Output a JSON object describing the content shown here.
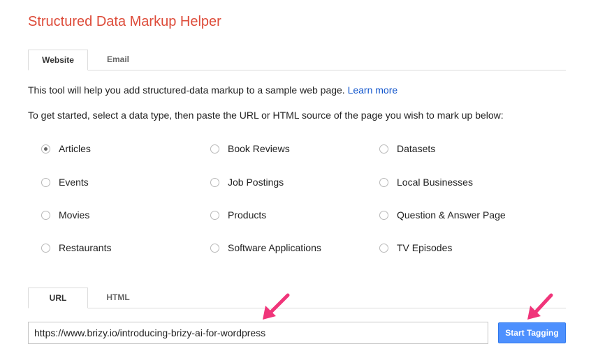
{
  "app": {
    "title": "Structured Data Markup Helper"
  },
  "source_tabs": [
    {
      "label": "Website",
      "active": true
    },
    {
      "label": "Email",
      "active": false
    }
  ],
  "intro": {
    "text": "This tool will help you add structured-data markup to a sample web page.",
    "link": "Learn more"
  },
  "instructions": "To get started, select a data type, then paste the URL or HTML source of the page you wish to mark up below:",
  "data_types": [
    {
      "label": "Articles",
      "checked": true
    },
    {
      "label": "Book Reviews",
      "checked": false
    },
    {
      "label": "Datasets",
      "checked": false
    },
    {
      "label": "Events",
      "checked": false
    },
    {
      "label": "Job Postings",
      "checked": false
    },
    {
      "label": "Local Businesses",
      "checked": false
    },
    {
      "label": "Movies",
      "checked": false
    },
    {
      "label": "Products",
      "checked": false
    },
    {
      "label": "Question & Answer Page",
      "checked": false
    },
    {
      "label": "Restaurants",
      "checked": false
    },
    {
      "label": "Software Applications",
      "checked": false
    },
    {
      "label": "TV Episodes",
      "checked": false
    }
  ],
  "input_tabs": [
    {
      "label": "URL",
      "active": true
    },
    {
      "label": "HTML",
      "active": false
    }
  ],
  "url_input": {
    "value": "https://www.brizy.io/introducing-brizy-ai-for-wordpress"
  },
  "start_button": {
    "label": "Start Tagging"
  },
  "colors": {
    "title": "#dd4b39",
    "link": "#1155cc",
    "button": "#4d90fe",
    "arrow": "#f0357a"
  }
}
